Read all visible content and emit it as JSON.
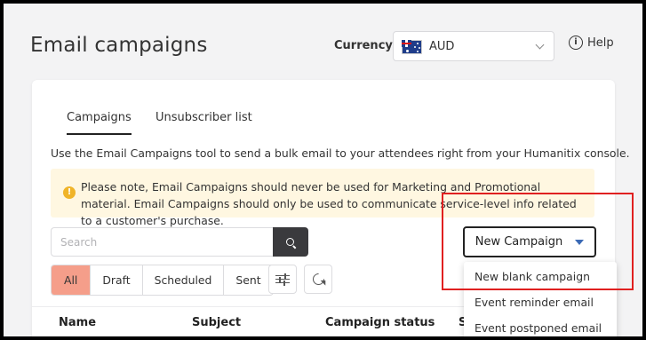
{
  "page": {
    "title": "Email campaigns"
  },
  "currency": {
    "label": "Currency:",
    "value": "AUD",
    "flag_icon": "australia-flag-icon"
  },
  "help": {
    "label": "Help",
    "icon": "info-circle-icon"
  },
  "tabs": [
    {
      "label": "Campaigns",
      "active": true
    },
    {
      "label": "Unsubscriber list",
      "active": false
    }
  ],
  "description": "Use the Email Campaigns tool to send a bulk email to your attendees right from your Humanitix console.",
  "notice": {
    "icon": "exclamation-circle-icon",
    "text": "Please note, Email Campaigns should never be used for Marketing and Promotional material. Email Campaigns should only be used to communicate service-level info related to a customer's purchase."
  },
  "search": {
    "placeholder": "Search",
    "value": ""
  },
  "new_campaign": {
    "label": "New Campaign"
  },
  "filters": [
    {
      "label": "All",
      "active": true
    },
    {
      "label": "Draft",
      "active": false
    },
    {
      "label": "Scheduled",
      "active": false
    },
    {
      "label": "Sent",
      "active": false
    }
  ],
  "table": {
    "columns": [
      "Name",
      "Subject",
      "Campaign status",
      "S"
    ]
  },
  "dropdown": {
    "items": [
      "New blank campaign",
      "Event reminder email",
      "Event postponed email"
    ]
  },
  "colors": {
    "accent_filter": "#f59e8a",
    "notice_bg": "#fff7e1",
    "annotation": "#e02020",
    "caret": "#3b6ab5"
  }
}
